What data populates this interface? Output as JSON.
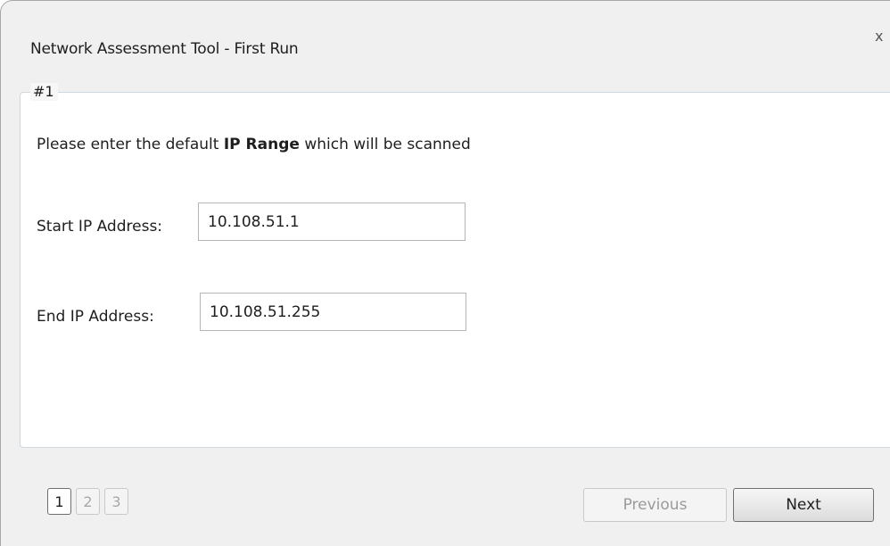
{
  "window": {
    "title": "Network Assessment Tool - First Run",
    "close_label": "x"
  },
  "group": {
    "legend": "#1",
    "instruction_prefix": "Please enter the default ",
    "instruction_bold": "IP Range",
    "instruction_suffix": " which will be scanned"
  },
  "fields": {
    "start_label": "Start IP Address:",
    "start_value": "10.108.51.1",
    "end_label": "End IP Address:",
    "end_value": "10.108.51.255"
  },
  "pager": {
    "pages": [
      "1",
      "2",
      "3"
    ],
    "current": "1"
  },
  "buttons": {
    "previous_label": "Previous",
    "next_label": "Next"
  }
}
